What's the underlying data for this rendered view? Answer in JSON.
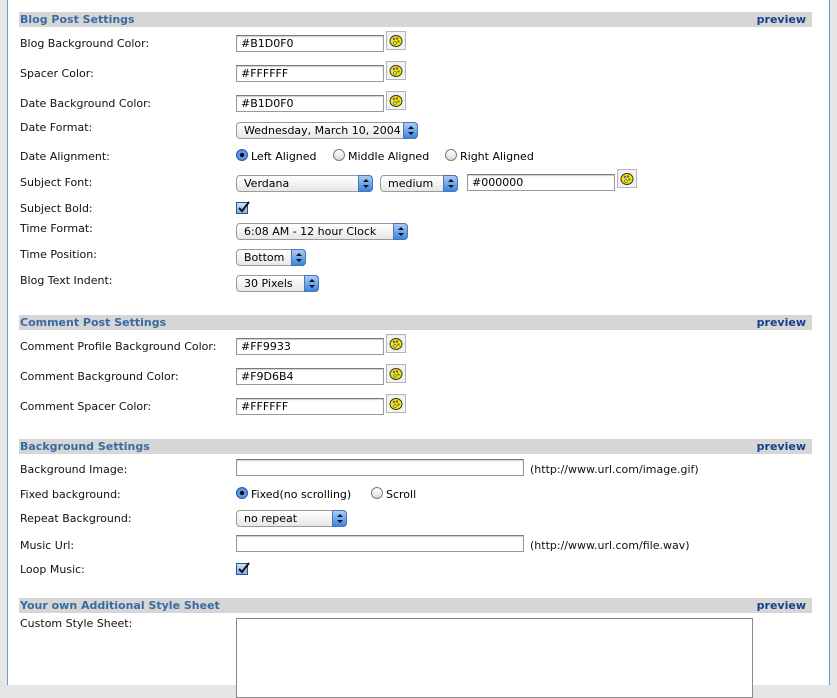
{
  "sections": {
    "blog_post": {
      "title": "Blog Post Settings",
      "preview": "preview"
    },
    "comment_post": {
      "title": "Comment Post Settings",
      "preview": "preview"
    },
    "background": {
      "title": "Background Settings",
      "preview": "preview"
    },
    "style_sheet": {
      "title": "Your own Additional Style Sheet",
      "preview": "preview"
    }
  },
  "blog_post": {
    "blog_bg_color": {
      "label": "Blog Background Color:",
      "value": "#B1D0F0"
    },
    "spacer_color": {
      "label": "Spacer Color:",
      "value": "#FFFFFF"
    },
    "date_bg_color": {
      "label": "Date Background Color:",
      "value": "#B1D0F0"
    },
    "date_format": {
      "label": "Date Format:",
      "value": "Wednesday, March 10, 2004"
    },
    "date_alignment": {
      "label": "Date Alignment:",
      "options": [
        "Left Aligned",
        "Middle Aligned",
        "Right Aligned"
      ],
      "selected": "Left Aligned"
    },
    "subject_font": {
      "label": "Subject Font:",
      "font": "Verdana",
      "size": "medium",
      "color": "#000000"
    },
    "subject_bold": {
      "label": "Subject Bold:",
      "checked": true
    },
    "time_format": {
      "label": "Time Format:",
      "value": "6:08 AM - 12 hour Clock"
    },
    "time_position": {
      "label": "Time Position:",
      "value": "Bottom"
    },
    "blog_text_indent": {
      "label": "Blog Text Indent:",
      "value": "30 Pixels"
    }
  },
  "comment_post": {
    "profile_bg_color": {
      "label": "Comment Profile Background Color:",
      "value": "#FF9933"
    },
    "comment_bg_color": {
      "label": "Comment Background Color:",
      "value": "#F9D6B4"
    },
    "comment_spacer_color": {
      "label": "Comment Spacer Color:",
      "value": "#FFFFFF"
    }
  },
  "background": {
    "image": {
      "label": "Background Image:",
      "value": "",
      "hint": "(http://www.url.com/image.gif)"
    },
    "fixed": {
      "label": "Fixed background:",
      "options": [
        "Fixed(no scrolling)",
        "Scroll"
      ],
      "selected": "Fixed(no scrolling)"
    },
    "repeat": {
      "label": "Repeat Background:",
      "value": "no repeat"
    },
    "music_url": {
      "label": "Music Url:",
      "value": "",
      "hint": "(http://www.url.com/file.wav)"
    },
    "loop_music": {
      "label": "Loop Music:",
      "checked": true
    }
  },
  "style_sheet": {
    "custom": {
      "label": "Custom Style Sheet:",
      "value": ""
    }
  },
  "icons": {
    "color_picker": "palette-icon"
  }
}
